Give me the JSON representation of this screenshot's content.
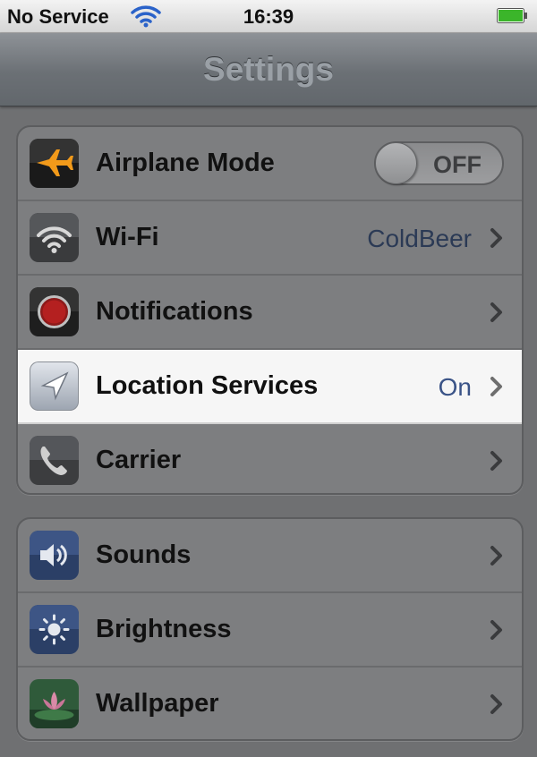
{
  "status_bar": {
    "carrier": "No Service",
    "time": "16:39",
    "wifi_icon": "wifi-signal-icon",
    "battery_icon": "battery-icon",
    "battery_color": "#3bb52a"
  },
  "nav": {
    "title": "Settings"
  },
  "groups": [
    {
      "rows": [
        {
          "label": "Airplane Mode",
          "icon": "airplane-icon",
          "toggle": "OFF"
        },
        {
          "label": "Wi-Fi",
          "icon": "wifi-icon",
          "value": "ColdBeer"
        },
        {
          "label": "Notifications",
          "icon": "notifications-icon"
        },
        {
          "label": "Location Services",
          "icon": "location-arrow-icon",
          "value": "On",
          "highlighted": true
        },
        {
          "label": "Carrier",
          "icon": "phone-icon"
        }
      ]
    },
    {
      "rows": [
        {
          "label": "Sounds",
          "icon": "speaker-icon"
        },
        {
          "label": "Brightness",
          "icon": "brightness-sun-icon"
        },
        {
          "label": "Wallpaper",
          "icon": "wallpaper-flower-icon"
        }
      ]
    }
  ],
  "colors": {
    "value_text": "#2b3a55",
    "highlight_row": "#f6f6f6",
    "overlay_gray": "#6f7072"
  }
}
